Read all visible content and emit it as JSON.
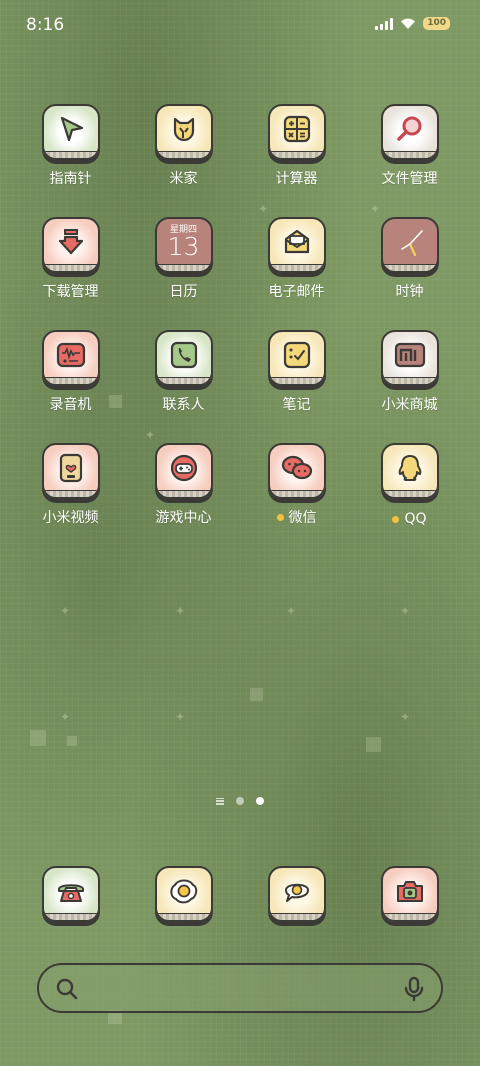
{
  "status_bar": {
    "time": "8:16",
    "battery": "100",
    "icons": [
      "signal-icon",
      "wifi-icon",
      "battery-icon"
    ]
  },
  "apps": [
    {
      "label": "指南针",
      "icon": "compass-icon",
      "bg": "green"
    },
    {
      "label": "米家",
      "icon": "mijia-cat-icon",
      "bg": "yellow"
    },
    {
      "label": "计算器",
      "icon": "calculator-icon",
      "bg": "yellow"
    },
    {
      "label": "文件管理",
      "icon": "file-search-icon",
      "bg": "gray"
    },
    {
      "label": "下载管理",
      "icon": "download-icon",
      "bg": "pink"
    },
    {
      "label": "日历",
      "icon": "calendar-icon",
      "bg": "rose",
      "calendar_weekday": "星期四",
      "calendar_day": "13"
    },
    {
      "label": "电子邮件",
      "icon": "mail-icon",
      "bg": "yellow"
    },
    {
      "label": "时钟",
      "icon": "clock-icon",
      "bg": "rose"
    },
    {
      "label": "录音机",
      "icon": "recorder-icon",
      "bg": "pink"
    },
    {
      "label": "联系人",
      "icon": "contacts-icon",
      "bg": "green"
    },
    {
      "label": "笔记",
      "icon": "notes-icon",
      "bg": "yellow"
    },
    {
      "label": "小米商城",
      "icon": "mi-store-icon",
      "bg": "gray"
    },
    {
      "label": "小米视频",
      "icon": "video-icon",
      "bg": "pink"
    },
    {
      "label": "游戏中心",
      "icon": "game-center-icon",
      "bg": "pink"
    },
    {
      "label": "微信",
      "icon": "wechat-icon",
      "bg": "pink",
      "badge_dot": true
    },
    {
      "label": "QQ",
      "icon": "qq-icon",
      "bg": "yellow",
      "badge_dot": true
    }
  ],
  "page_indicator": {
    "pages": 2,
    "active_page": 2
  },
  "dock": [
    {
      "icon": "phone-icon",
      "bg": "green"
    },
    {
      "icon": "egg-icon",
      "bg": "yellow"
    },
    {
      "icon": "message-icon",
      "bg": "yellow"
    },
    {
      "icon": "camera-icon",
      "bg": "pink"
    }
  ],
  "search": {
    "placeholder": ""
  },
  "colors": {
    "wallpaper": "#7e9963",
    "outline": "#3b3a36",
    "badge": "#f3c33f"
  }
}
